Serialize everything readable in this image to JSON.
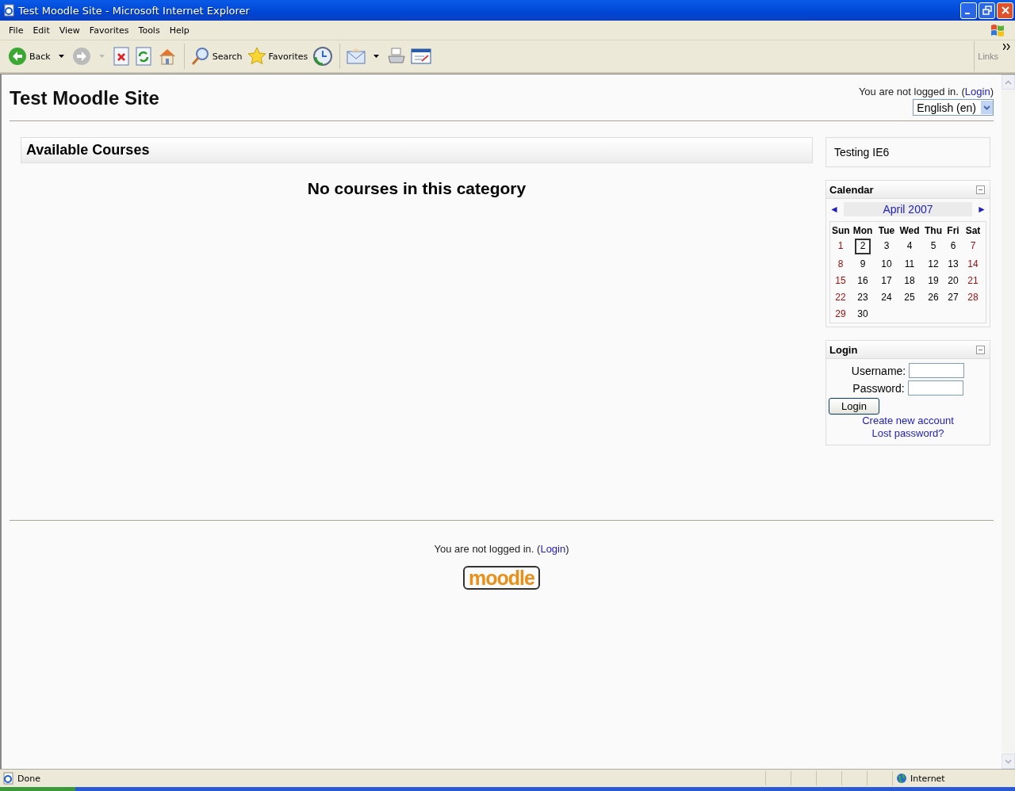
{
  "window": {
    "title": "Test Moodle Site - Microsoft Internet Explorer"
  },
  "menu": [
    "File",
    "Edit",
    "View",
    "Favorites",
    "Tools",
    "Help"
  ],
  "toolbar": {
    "back": "Back",
    "search": "Search",
    "favorites": "Favorites",
    "links": "Links"
  },
  "page": {
    "site_title": "Test Moodle Site",
    "login_info": {
      "prefix": "You are not logged in. (",
      "link": "Login",
      "suffix": ")"
    },
    "language": "English (en)",
    "available_courses": {
      "heading": "Available Courses",
      "message": "No courses in this category"
    },
    "summary_block": {
      "text": "Testing IE6"
    },
    "calendar": {
      "title": "Calendar",
      "month": "April 2007",
      "prev": "◄",
      "next": "►",
      "weekdays": [
        "Sun",
        "Mon",
        "Tue",
        "Wed",
        "Thu",
        "Fri",
        "Sat"
      ],
      "weeks": [
        [
          {
            "day": "1",
            "weekend": true,
            "today": false
          },
          {
            "day": "2",
            "weekend": false,
            "today": true
          },
          {
            "day": "3",
            "weekend": false,
            "today": false
          },
          {
            "day": "4",
            "weekend": false,
            "today": false
          },
          {
            "day": "5",
            "weekend": false,
            "today": false
          },
          {
            "day": "6",
            "weekend": false,
            "today": false
          },
          {
            "day": "7",
            "weekend": true,
            "today": false
          }
        ],
        [
          {
            "day": "8",
            "weekend": true,
            "today": false
          },
          {
            "day": "9",
            "weekend": false,
            "today": false
          },
          {
            "day": "10",
            "weekend": false,
            "today": false
          },
          {
            "day": "11",
            "weekend": false,
            "today": false
          },
          {
            "day": "12",
            "weekend": false,
            "today": false
          },
          {
            "day": "13",
            "weekend": false,
            "today": false
          },
          {
            "day": "14",
            "weekend": true,
            "today": false
          }
        ],
        [
          {
            "day": "15",
            "weekend": true,
            "today": false
          },
          {
            "day": "16",
            "weekend": false,
            "today": false
          },
          {
            "day": "17",
            "weekend": false,
            "today": false
          },
          {
            "day": "18",
            "weekend": false,
            "today": false
          },
          {
            "day": "19",
            "weekend": false,
            "today": false
          },
          {
            "day": "20",
            "weekend": false,
            "today": false
          },
          {
            "day": "21",
            "weekend": true,
            "today": false
          }
        ],
        [
          {
            "day": "22",
            "weekend": true,
            "today": false
          },
          {
            "day": "23",
            "weekend": false,
            "today": false
          },
          {
            "day": "24",
            "weekend": false,
            "today": false
          },
          {
            "day": "25",
            "weekend": false,
            "today": false
          },
          {
            "day": "26",
            "weekend": false,
            "today": false
          },
          {
            "day": "27",
            "weekend": false,
            "today": false
          },
          {
            "day": "28",
            "weekend": true,
            "today": false
          }
        ],
        [
          {
            "day": "29",
            "weekend": true,
            "today": false
          },
          {
            "day": "30",
            "weekend": false,
            "today": false
          }
        ]
      ]
    },
    "login_block": {
      "title": "Login",
      "username_label": "Username:",
      "password_label": "Password:",
      "button": "Login",
      "create_account": "Create new account",
      "lost_password": "Lost password?"
    },
    "footer": {
      "login_info": {
        "prefix": "You are not logged in. (",
        "link": "Login",
        "suffix": ")"
      },
      "logo": "moodle"
    }
  },
  "status_bar": {
    "text": "Done",
    "zone": "Internet"
  }
}
